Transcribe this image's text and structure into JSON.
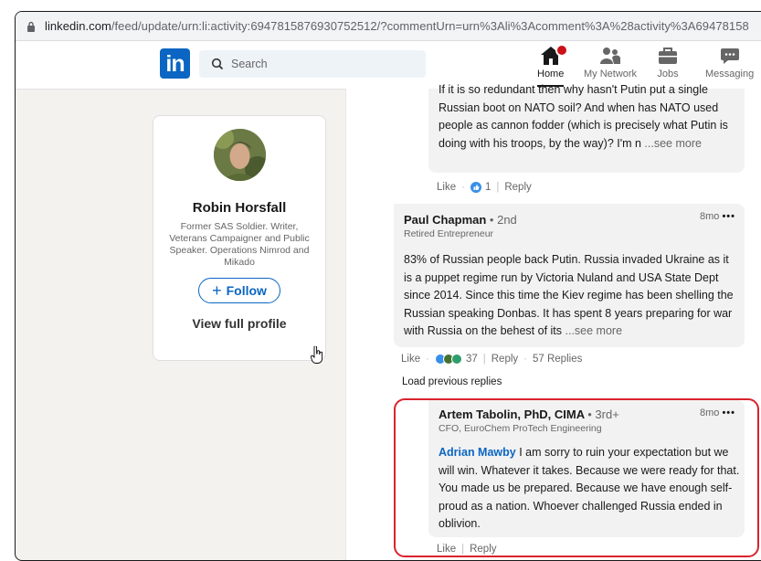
{
  "browser": {
    "url_host": "linkedin.com",
    "url_rest": "/feed/update/urn:li:activity:6947815876930752512/?commentUrn=urn%3Ali%3Acomment%3A%28activity%3A69478158"
  },
  "nav": {
    "logo": "in",
    "search_placeholder": "Search",
    "items": [
      {
        "label": "Home",
        "icon": "home-icon"
      },
      {
        "label": "My Network",
        "icon": "network-icon"
      },
      {
        "label": "Jobs",
        "icon": "briefcase-icon"
      },
      {
        "label": "Messaging",
        "icon": "messaging-icon"
      }
    ]
  },
  "profile": {
    "name": "Robin Horsfall",
    "headline": "Former SAS Soldier. Writer, Veterans Campaigner and Public Speaker. Operations Nimrod and Mikado",
    "follow": "Follow",
    "view_profile": "View full profile"
  },
  "comments": [
    {
      "text": "If it is so redundant then why hasn't Putin put a single Russian boot on NATO soil? And when has NATO used people as cannon fodder (which is precisely what Putin is doing with his troops, by the way)? I'm n",
      "see_more": "...see more",
      "like": "Like",
      "reactions": "1",
      "reply": "Reply"
    },
    {
      "author": "Paul Chapman",
      "degree": "• 2nd",
      "headline": "Retired Entrepreneur",
      "time": "8mo",
      "text": "83% of Russian people back Putin. Russia invaded Ukraine as it is a puppet regime run by Victoria Nuland and USA State Dept since 2014. Since this time the Kiev regime has been shelling the Russian speaking Donbas. It has spent 8 years preparing for war with Russia on the behest of its",
      "see_more": "...see more",
      "like": "Like",
      "reactions": "37",
      "reply": "Reply",
      "replies": "57 Replies"
    },
    {
      "load_previous": "Load previous replies",
      "author": "Artem Tabolin, PhD, CIMA",
      "degree": "• 3rd+",
      "headline": "CFO, EuroChem ProTech Engineering",
      "time": "8mo",
      "mention": "Adrian Mawby",
      "text": "I am sorry to ruin your expectation but we will win. Whatever it takes. Because we were ready for that. You made us be prepared. Because we have enough self-proud as a nation. Whoever challenged Russia ended in oblivion.",
      "like": "Like",
      "reply": "Reply"
    }
  ],
  "colors": {
    "linkedin_blue": "#0a66c2",
    "highlight_red": "#d9232d",
    "badge_red": "#cc1016"
  }
}
